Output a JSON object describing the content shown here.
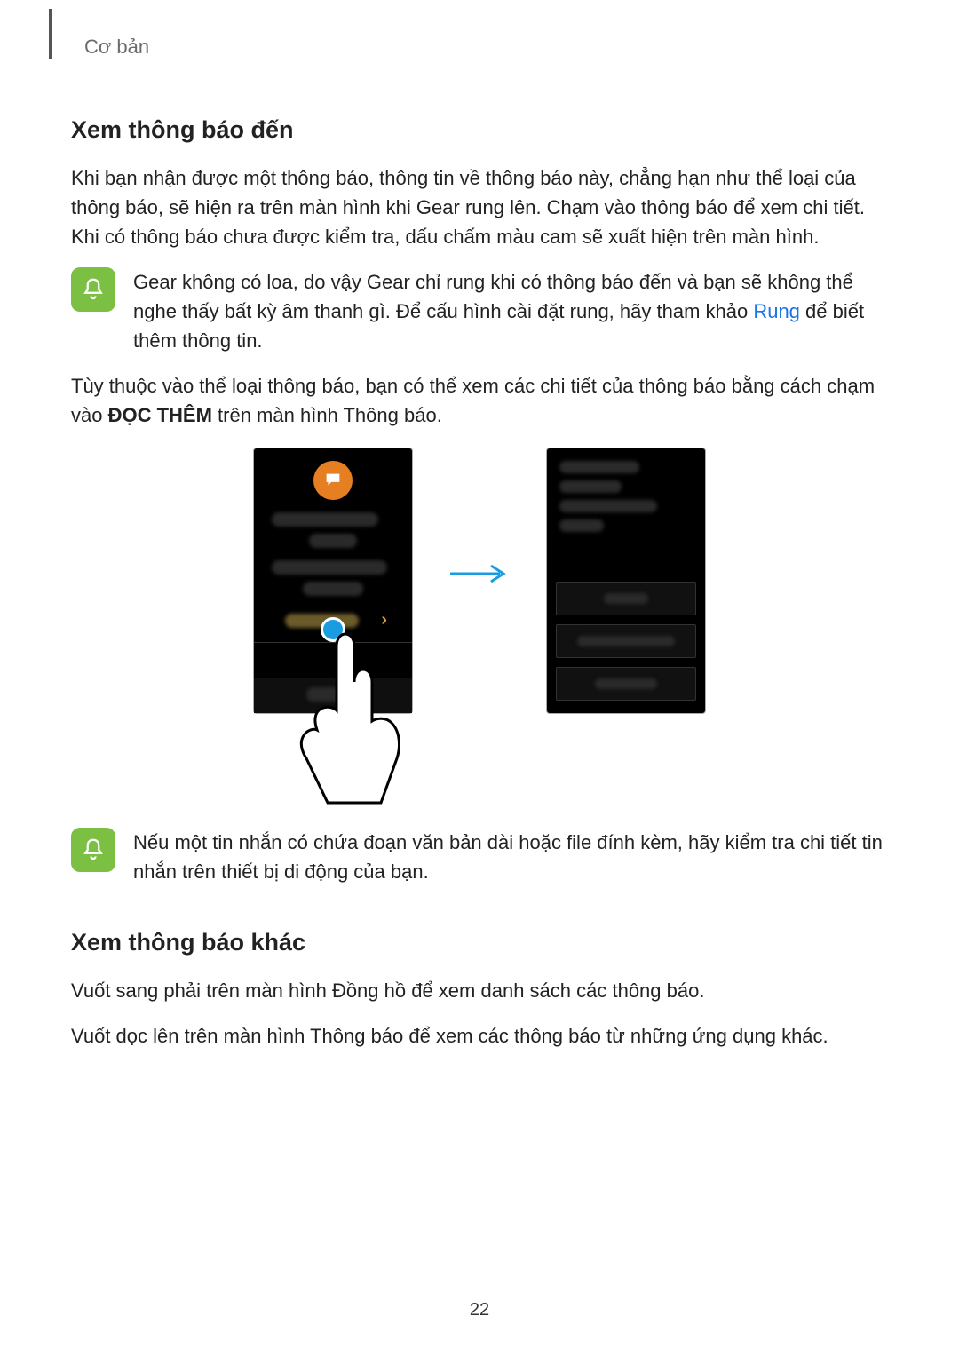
{
  "breadcrumb": "Cơ bản",
  "section1": {
    "title": "Xem thông báo đến",
    "p1": "Khi bạn nhận được một thông báo, thông tin về thông báo này, chẳng hạn như thể loại của thông báo, sẽ hiện ra trên màn hình khi Gear rung lên. Chạm vào thông báo để xem chi tiết. Khi có thông báo chưa được kiểm tra, dấu chấm màu cam sẽ xuất hiện trên màn hình.",
    "note1_a": "Gear không có loa, do vậy Gear chỉ rung khi có thông báo đến và bạn sẽ không thể nghe thấy bất kỳ âm thanh gì. Để cấu hình cài đặt rung, hãy tham khảo ",
    "note1_link": "Rung",
    "note1_b": " để biết thêm thông tin.",
    "p2_a": "Tùy thuộc vào thể loại thông báo, bạn có thể xem các chi tiết của thông báo bằng cách chạm vào ",
    "p2_bold": "ĐỌC THÊM",
    "p2_b": " trên màn hình Thông báo.",
    "note2": "Nếu một tin nhắn có chứa đoạn văn bản dài hoặc file đính kèm, hãy kiểm tra chi tiết tin nhắn trên thiết bị di động của bạn."
  },
  "section2": {
    "title": "Xem thông báo khác",
    "p1": "Vuốt sang phải trên màn hình Đồng hồ để xem danh sách các thông báo.",
    "p2": "Vuốt dọc lên trên màn hình Thông báo để xem các thông báo từ những ứng dụng khác."
  },
  "page_number": "22"
}
